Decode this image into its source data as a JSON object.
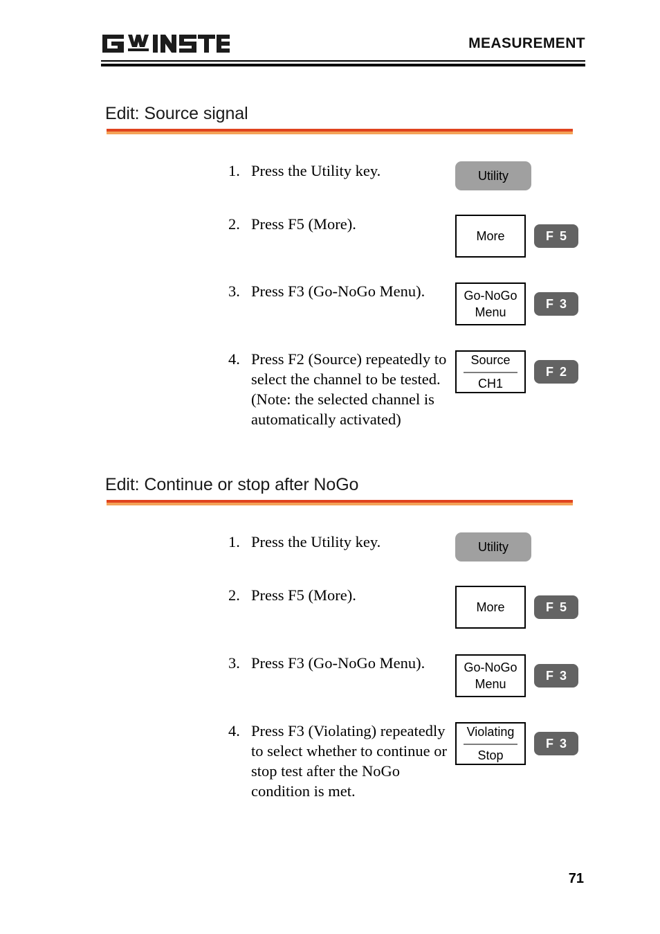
{
  "header": {
    "brand": "GW INSTEK",
    "title": "MEASUREMENT"
  },
  "sections": [
    {
      "heading": "Edit: Source signal",
      "steps": [
        {
          "number": "1.",
          "text": "Press the Utility key.",
          "key_type": "utility",
          "utility_label": "Utility"
        },
        {
          "number": "2.",
          "text": "Press F5 (More).",
          "key_type": "soft",
          "soft_lines": [
            "More"
          ],
          "f_letter": "F",
          "f_digit": "5"
        },
        {
          "number": "3.",
          "text": "Press F3 (Go-NoGo Menu).",
          "key_type": "soft",
          "soft_lines": [
            "Go-NoGo",
            "Menu"
          ],
          "f_letter": "F",
          "f_digit": "3"
        },
        {
          "number": "4.",
          "text": "Press F2 (Source) repeatedly to select the channel to be tested. (Note: the selected channel is automatically activated)",
          "key_type": "soft-split",
          "soft_lines": [
            "Source",
            "CH1"
          ],
          "f_letter": "F",
          "f_digit": "2"
        }
      ]
    },
    {
      "heading": "Edit: Continue or stop after NoGo",
      "steps": [
        {
          "number": "1.",
          "text": "Press the Utility key.",
          "key_type": "utility",
          "utility_label": "Utility"
        },
        {
          "number": "2.",
          "text": "Press F5 (More).",
          "key_type": "soft",
          "soft_lines": [
            "More"
          ],
          "f_letter": "F",
          "f_digit": "5"
        },
        {
          "number": "3.",
          "text": "Press F3 (Go-NoGo Menu).",
          "key_type": "soft",
          "soft_lines": [
            "Go-NoGo",
            "Menu"
          ],
          "f_letter": "F",
          "f_digit": "3"
        },
        {
          "number": "4.",
          "text": "Press F3 (Violating) repeatedly to select whether to continue or stop test after the NoGo condition is met.",
          "key_type": "soft-split",
          "soft_lines": [
            "Violating",
            "Stop"
          ],
          "f_letter": "F",
          "f_digit": "3"
        }
      ]
    }
  ],
  "footer": {
    "page_number": "71"
  },
  "colors": {
    "accent_rule": "#e0441f",
    "accent_rule_light": "#f4a358",
    "function_key_bg": "#636363",
    "utility_key_bg": "#a0a0a0"
  }
}
